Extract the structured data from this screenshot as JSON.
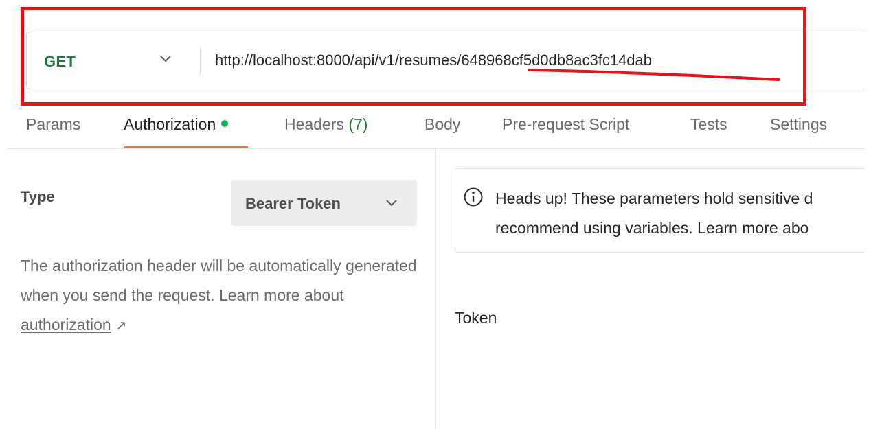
{
  "request": {
    "method": "GET",
    "url": "http://localhost:8000/api/v1/resumes/648968cf5d0db8ac3fc14dab"
  },
  "tabs": [
    {
      "label": "Params"
    },
    {
      "label": "Authorization",
      "active": true
    },
    {
      "label": "Headers",
      "count": "(7)"
    },
    {
      "label": "Body"
    },
    {
      "label": "Pre-request Script"
    },
    {
      "label": "Tests"
    },
    {
      "label": "Settings"
    }
  ],
  "auth": {
    "type_label": "Type",
    "type_value": "Bearer Token",
    "help_text": "The authorization header will be automatically generated when you send the request. Learn more about ",
    "help_link": "authorization",
    "help_link_arrow": "↗"
  },
  "notice": {
    "line1": "Heads up! These parameters hold sensitive d",
    "line2": "recommend using variables. Learn more abo"
  },
  "token": {
    "label": "Token"
  },
  "colors": {
    "method_get": "#1b7a3e",
    "tab_active_underline": "#ff6c37",
    "tab_dot": "#0cbb52",
    "annotation_red": "#e8121b"
  },
  "icons": {
    "method_dropdown": "chevron-down-icon",
    "auth_type_dropdown": "chevron-down-icon",
    "notice": "info-icon",
    "help_link": "external-link-arrow-icon"
  }
}
